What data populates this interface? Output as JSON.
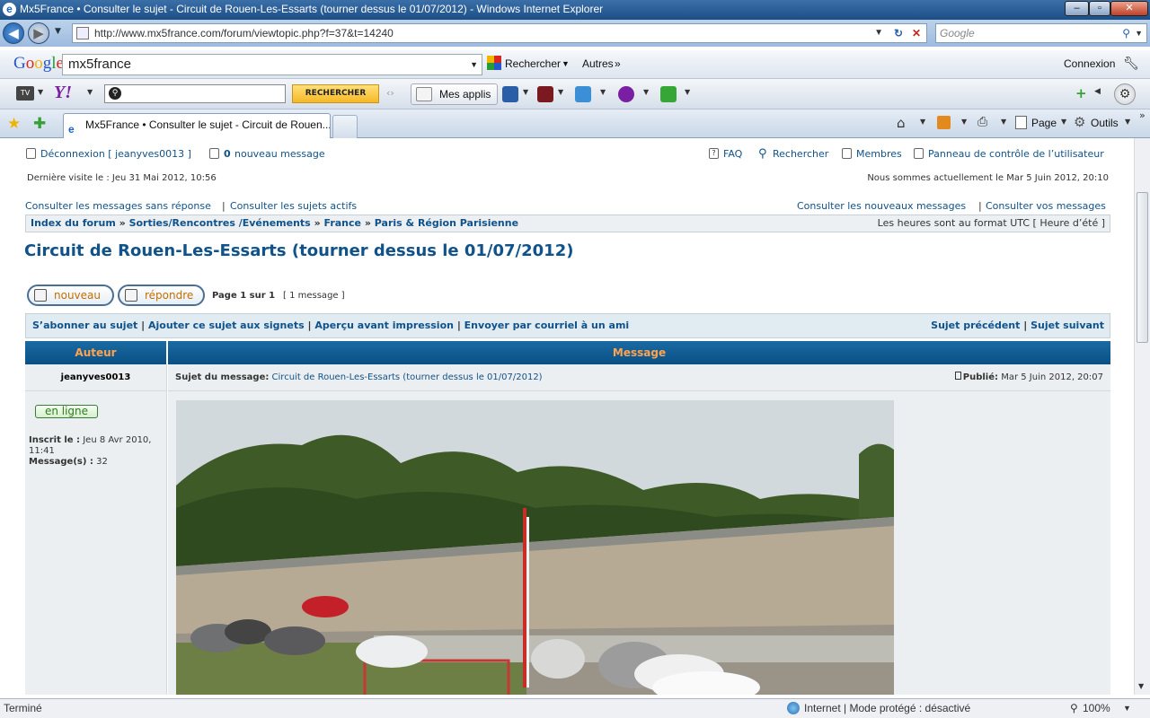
{
  "window": {
    "title": "Mx5France • Consulter le sujet - Circuit de Rouen-Les-Essarts (tourner dessus le 01/07/2012) - Windows Internet Explorer"
  },
  "nav": {
    "url": "http://www.mx5france.com/forum/viewtopic.php?f=37&t=14240",
    "search_placeholder": "Google"
  },
  "google_toolbar": {
    "logo": "Google",
    "query": "mx5france",
    "search_label": "Rechercher",
    "more_label": "Autres",
    "signin_label": "Connexion"
  },
  "yahoo_toolbar": {
    "search_button": "RECHERCHER",
    "apps_label": "Mes applis"
  },
  "tabs": [
    {
      "label": "Mx5France • Consulter le sujet - Circuit de Rouen..."
    }
  ],
  "command_bar": {
    "page_label": "Page",
    "tools_label": "Outils"
  },
  "forum": {
    "logout": "Déconnexion [ jeanyves0013 ]",
    "new_pm_count": "0",
    "new_pm_label": "nouveau message",
    "faq": "FAQ",
    "search": "Rechercher",
    "members": "Membres",
    "ucp": "Panneau de contrôle de l’utilisateur",
    "last_visit": "Dernière visite le : Jeu 31 Mai 2012, 10:56",
    "current_time": "Nous sommes actuellement le Mar 5 Juin 2012, 20:10",
    "unanswered": "Consulter les messages sans réponse",
    "active": "Consulter les sujets actifs",
    "new_posts": "Consulter les nouveaux messages",
    "your_posts": "Consulter vos messages",
    "breadcrumb": [
      "Index du forum",
      "Sorties/Rencontres /Evénements",
      "France",
      "Paris & Région Parisienne"
    ],
    "timezone": "Les heures sont au format UTC [ Heure d’été ]",
    "topic_title": "Circuit de Rouen-Les-Essarts (tourner dessus le 01/07/2012)",
    "btn_new": "nouveau",
    "btn_reply": "répondre",
    "pagination": "Page 1 sur 1",
    "msg_count": "[ 1 message ]",
    "actions": [
      "S’abonner au sujet",
      "Ajouter ce sujet aux signets",
      "Aperçu avant impression",
      "Envoyer par courriel à un ami"
    ],
    "prev_topic": "Sujet précédent",
    "next_topic": "Sujet suivant",
    "col_author": "Auteur",
    "col_message": "Message",
    "post": {
      "author": "jeanyves0013",
      "subject_label": "Sujet du message:",
      "subject": "Circuit de Rouen-Les-Essarts (tourner dessus le 01/07/2012)",
      "published_label": "Publié:",
      "published": "Mar 5 Juin 2012, 20:07",
      "online": "en ligne",
      "joined_label": "Inscrit le :",
      "joined": "Jeu 8 Avr 2010, 11:41",
      "posts_label": "Message(s) :",
      "posts": "32"
    }
  },
  "status": {
    "left": "Terminé",
    "zone": "Internet | Mode protégé : désactivé",
    "zoom": "100%"
  }
}
